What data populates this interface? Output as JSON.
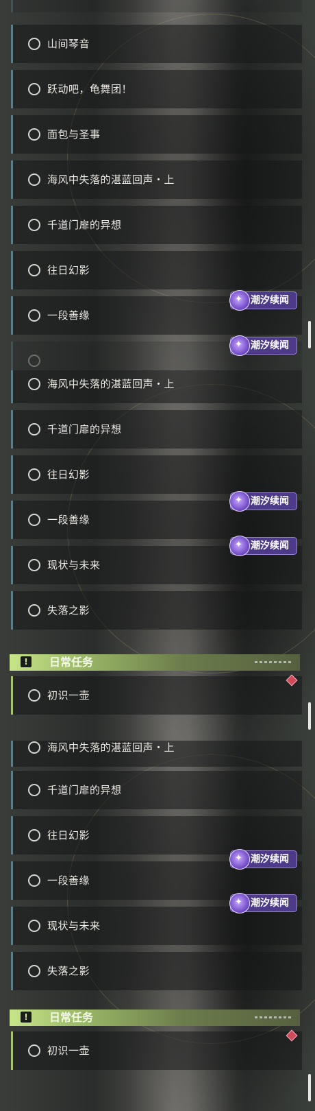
{
  "tag_label": "潮汐续闻",
  "panel1": {
    "items": [
      {
        "label": "山间琴音"
      },
      {
        "label": "跃动吧，龟舞团！"
      },
      {
        "label": "面包与圣事"
      },
      {
        "label": "海风中失落的湛蓝回声・上"
      },
      {
        "label": "千道门扉的异想"
      },
      {
        "label": "往日幻影"
      },
      {
        "label": "一段善缘"
      }
    ]
  },
  "panel2": {
    "items": [
      {
        "label": "海风中失落的湛蓝回声・上"
      },
      {
        "label": "千道门扉的异想"
      },
      {
        "label": "往日幻影"
      },
      {
        "label": "一段善缘"
      },
      {
        "label": "现状与未来"
      },
      {
        "label": "失落之影"
      }
    ],
    "section_title": "日常任务",
    "daily_items": [
      {
        "label": "初识一壶"
      }
    ]
  },
  "panel3": {
    "items": [
      {
        "label": "海风中失落的湛蓝回声・上"
      },
      {
        "label": "千道门扉的异想"
      },
      {
        "label": "往日幻影"
      },
      {
        "label": "一段善缘"
      },
      {
        "label": "现状与未来"
      },
      {
        "label": "失落之影"
      }
    ],
    "section_title": "日常任务",
    "daily_items": [
      {
        "label": "初识一壶"
      }
    ]
  }
}
